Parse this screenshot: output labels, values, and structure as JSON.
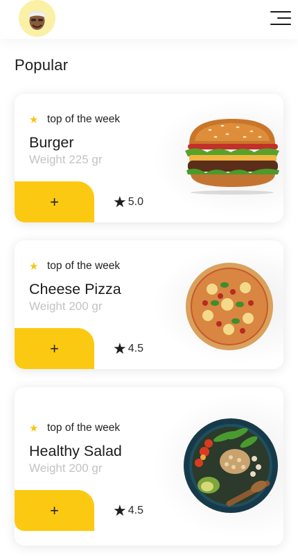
{
  "header": {
    "avatar_icon": "user-avatar-icon",
    "menu_icon": "hamburger-menu-icon"
  },
  "section": {
    "title": "Popular"
  },
  "accent_color": "#fcc912",
  "products": [
    {
      "tag": "top of the week",
      "name": "Burger",
      "weight": "Weight 225 gr",
      "add_label": "+",
      "rating": "5.0",
      "image_icon": "burger-image"
    },
    {
      "tag": "top of the week",
      "name": "Cheese Pizza",
      "weight": "Weight 200 gr",
      "add_label": "+",
      "rating": "4.5",
      "image_icon": "pizza-image"
    },
    {
      "tag": "top of the week",
      "name": "Healthy Salad",
      "weight": "Weight 200 gr",
      "add_label": "+",
      "rating": "4.5",
      "image_icon": "salad-bowl-image"
    }
  ]
}
